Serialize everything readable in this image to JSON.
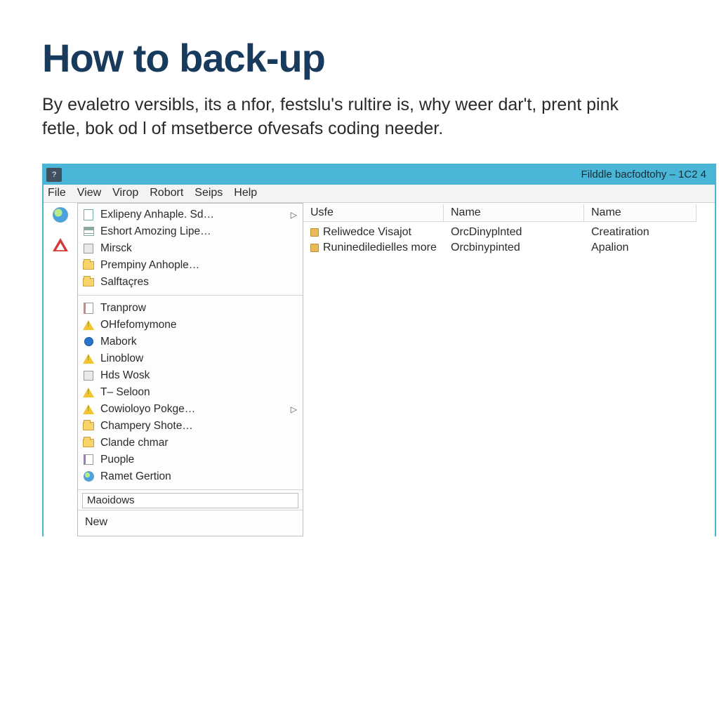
{
  "article": {
    "title": "How to back-up",
    "paragraph": "By evaletro versibls, its a nfor, festslu's rultire is, why weer dar't, prent pink fetle, bok od l of msetberce ofvesafs coding needer."
  },
  "window": {
    "title": "Filddle bacfodtohy – 1C2 4",
    "sysicon_glyph": "?"
  },
  "menubar": [
    "File",
    "View",
    "Virop",
    "Robort",
    "Seips",
    "Help"
  ],
  "dropdown": {
    "group1": [
      {
        "label": "Exlipeny Anhaple. Sd…",
        "icon": "doc",
        "has_sub": true
      },
      {
        "label": "Eshort Amozing Lipe…",
        "icon": "list",
        "has_sub": false
      },
      {
        "label": "Mirsck",
        "icon": "tree",
        "has_sub": false
      },
      {
        "label": "Prempiny Anhople…",
        "icon": "folder",
        "has_sub": false
      },
      {
        "label": "Salftaçres",
        "icon": "folder",
        "has_sub": false
      }
    ],
    "group2": [
      {
        "label": "Tranprow",
        "icon": "note",
        "has_sub": false
      },
      {
        "label": "OHfefomymone",
        "icon": "warning",
        "has_sub": false
      },
      {
        "label": "Mabork",
        "icon": "blue",
        "has_sub": false
      },
      {
        "label": "Linoblow",
        "icon": "warning",
        "has_sub": false
      },
      {
        "label": "Hds Wosk",
        "icon": "tree",
        "has_sub": false
      },
      {
        "label": "T– Seloon",
        "icon": "warning",
        "has_sub": false
      },
      {
        "label": "Cowioloyo Pokge…",
        "icon": "warning",
        "has_sub": true
      },
      {
        "label": "Champery Shote…",
        "icon": "folder",
        "has_sub": false
      },
      {
        "label": "Clande chmar",
        "icon": "folder",
        "has_sub": false
      },
      {
        "label": "Puople",
        "icon": "purple",
        "has_sub": false
      },
      {
        "label": "Ramet Gertion",
        "icon": "globe",
        "has_sub": false
      }
    ],
    "input_value": "Maoidows",
    "new_label": "New"
  },
  "table": {
    "headers": [
      "Usfe",
      "Name",
      "Name"
    ],
    "rows": [
      {
        "c0": "Reliwedce Visajot",
        "c1": "OrcDinyplnted",
        "c2": "Creatiration"
      },
      {
        "c0": "Runinediledielles more",
        "c1": "Orcbinypinted",
        "c2": "Apalion"
      }
    ]
  }
}
